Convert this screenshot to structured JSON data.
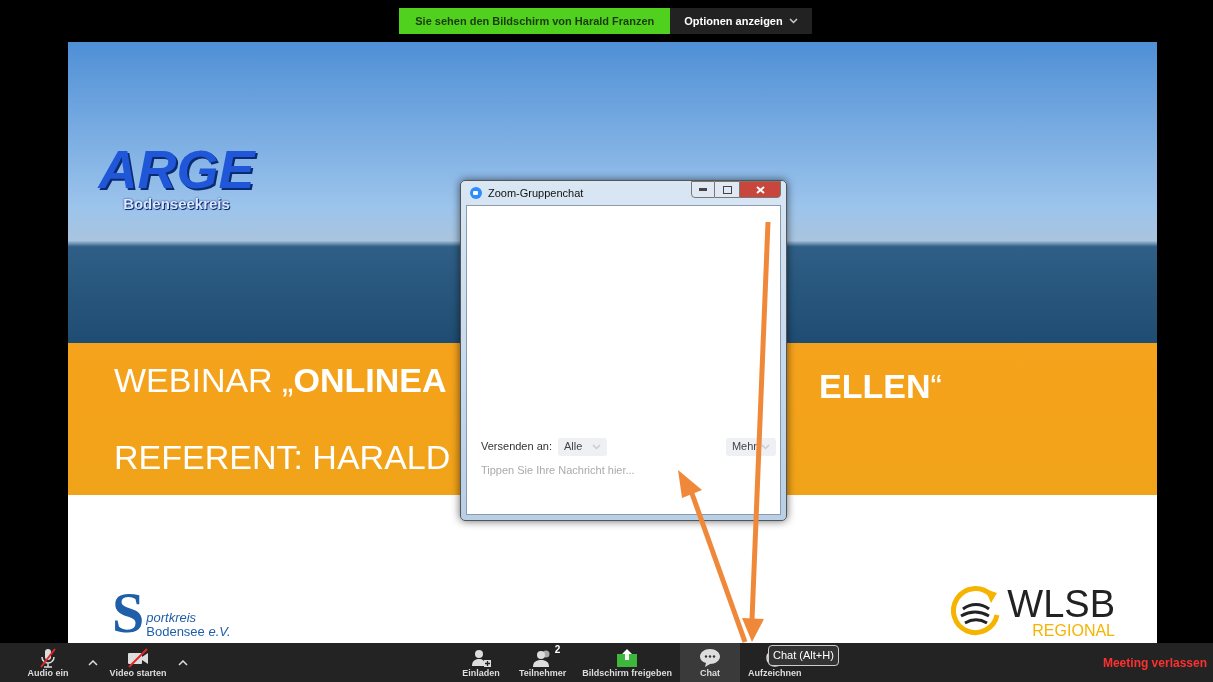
{
  "share_banner": {
    "text": "Sie sehen den Bildschirm von Harald Franzen",
    "options": "Optionen anzeigen"
  },
  "slide": {
    "logo_top": {
      "title": "ARGE",
      "subtitle": "Bodenseekreis"
    },
    "title_left": "WEBINAR „**ONLINEA**",
    "title_right": "**ELLEN**“",
    "speaker": "REFERENT: HARALD",
    "logo_left": {
      "letter": "S",
      "line1": "portkreis",
      "line2": "Bodensee",
      "suffix": "e.V."
    },
    "logo_right": {
      "name": "WLSB",
      "sub": "REGIONAL"
    }
  },
  "chat_window": {
    "title": "Zoom-Gruppenchat",
    "send_to_label": "Versenden an:",
    "recipient": "Alle",
    "more": "Mehr",
    "placeholder": "Tippen Sie Ihre Nachricht hier..."
  },
  "toolbar": {
    "left": [
      {
        "kind": "audio",
        "label": "Audio ein",
        "muted": true
      },
      {
        "kind": "video",
        "label": "Video starten",
        "muted": true
      }
    ],
    "center": [
      {
        "kind": "invite",
        "label": "Einladen",
        "selected": false
      },
      {
        "kind": "participants",
        "label": "Teilnehmer",
        "count": "2",
        "selected": false
      },
      {
        "kind": "share",
        "label": "Bildschirm freigeben",
        "selected": false
      },
      {
        "kind": "chat",
        "label": "Chat",
        "selected": true
      },
      {
        "kind": "record",
        "label": "Aufzeichnen",
        "selected": false
      }
    ],
    "tooltip": "Chat (Alt+H)",
    "leave": "Meeting verlassen"
  }
}
